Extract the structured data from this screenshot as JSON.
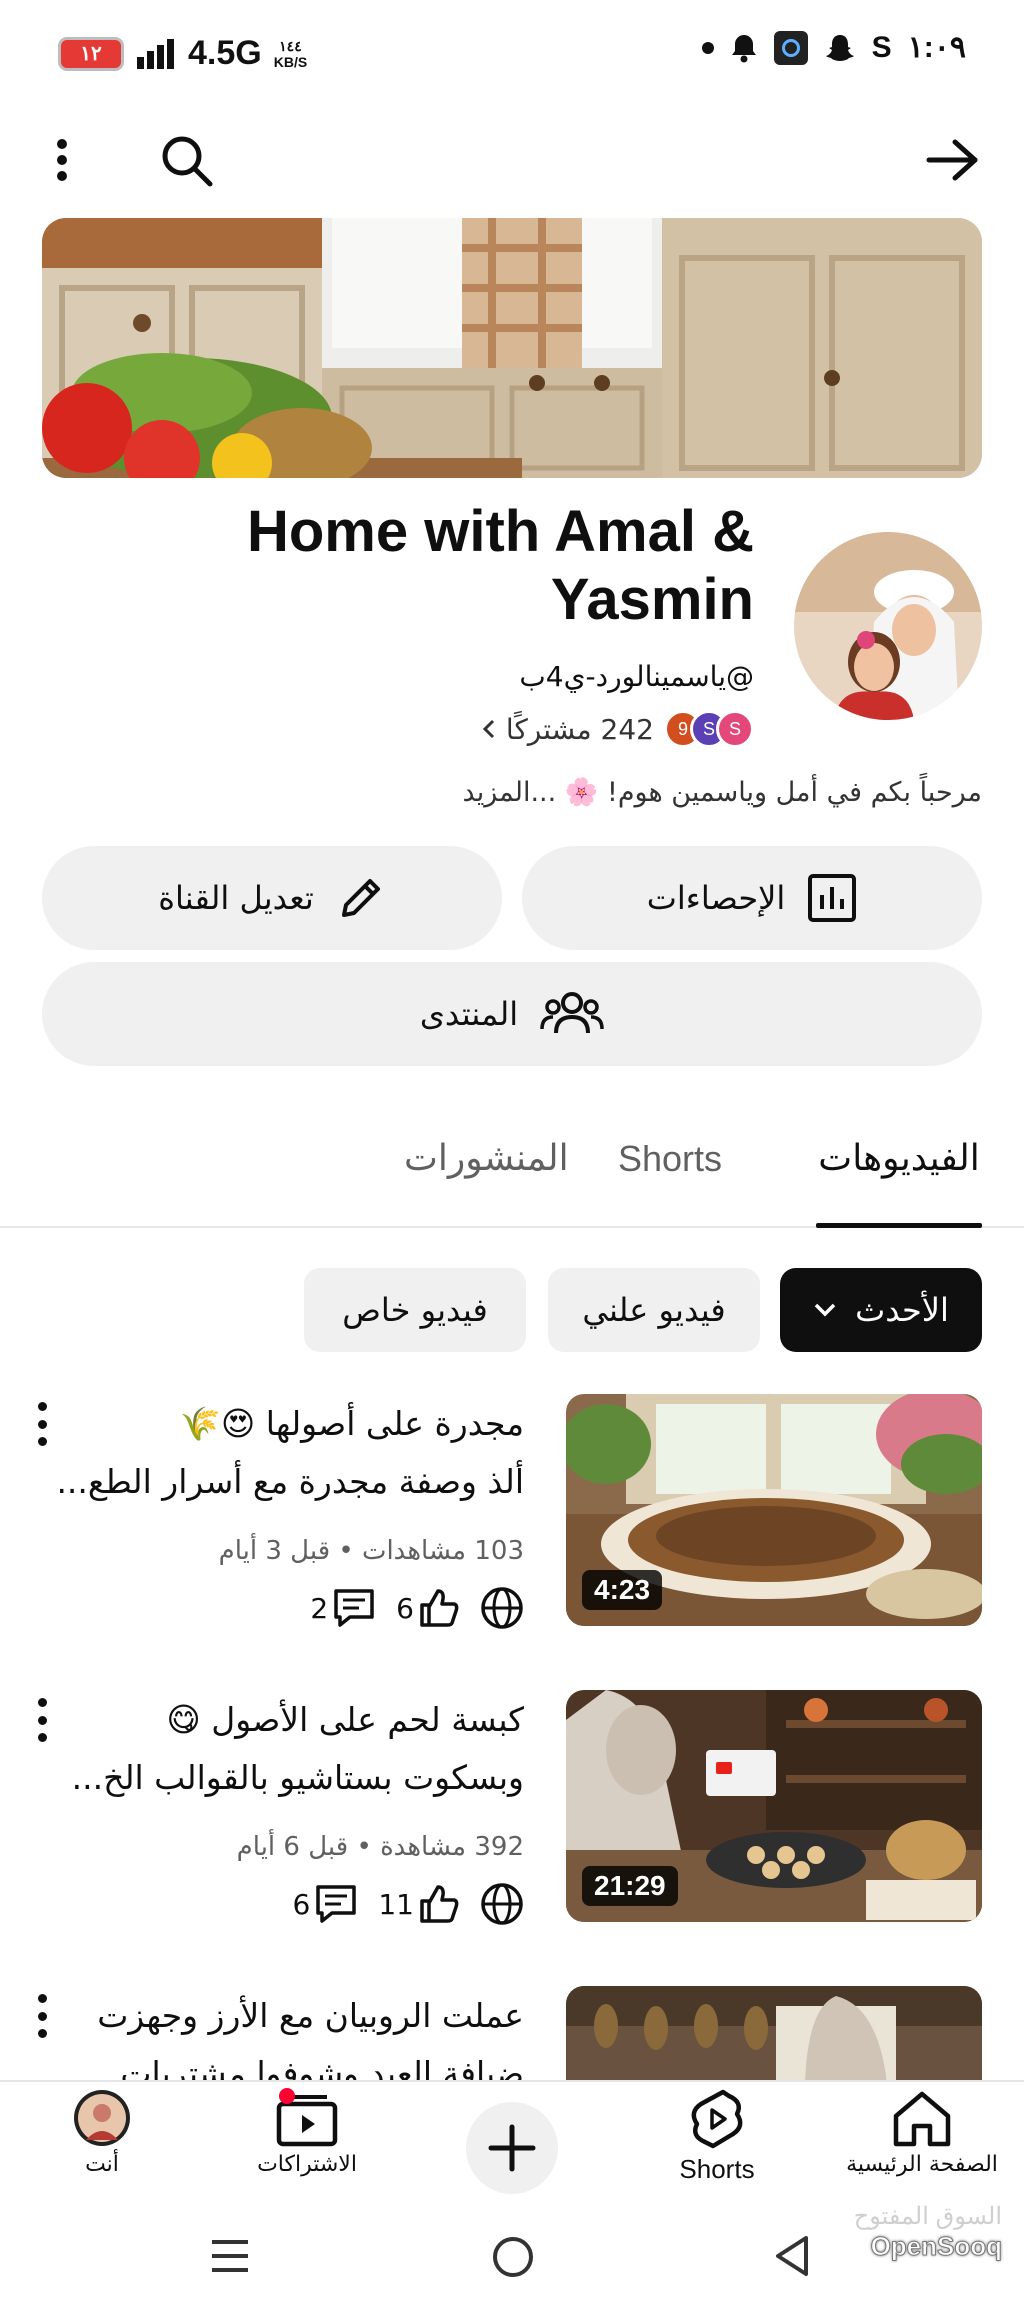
{
  "status_bar": {
    "battery": "١٢",
    "network": "4.5G",
    "speed_value": "١٤٤",
    "speed_unit": "KB/S",
    "time": "١:٠٩",
    "carrier_letter": "S"
  },
  "channel": {
    "title": "Home with Amal & Yasmin",
    "handle": "@ياسمينالورد-ي4ب",
    "subscribers": "242 مشتركًا",
    "description": "مرحباً بكم في أمل وياسمين هوم! 🌸 ...المزيد",
    "sub_avatars": [
      "S",
      "S",
      "9"
    ]
  },
  "actions": {
    "stats_label": "الإحصاءات",
    "edit_label": "تعديل القناة",
    "community_label": "المنتدى"
  },
  "tabs": {
    "videos": "الفيديوهات",
    "shorts": "Shorts",
    "posts": "المنشورات"
  },
  "filters": {
    "latest": "الأحدث",
    "public": "فيديو علني",
    "private": "فيديو خاص"
  },
  "videos": [
    {
      "title_line1": "مجدرة على أصولها 😍🌾",
      "title_line2": "ألذ وصفة مجدرة مع أسرار الطع...",
      "meta": "103 مشاهدات • قبل 3 أيام",
      "likes": "6",
      "comments": "2",
      "duration": "4:23"
    },
    {
      "title_line1": "كبسة لحم على الأصول 😋",
      "title_line2": "وبسكوت بستاشيو بالقوالب الخ...",
      "meta": "392 مشاهدة • قبل 6 أيام",
      "likes": "11",
      "comments": "6",
      "duration": "21:29"
    },
    {
      "title_line1": "عملت الروبيان مع الأرز وجهزت",
      "title_line2": "ضيافة العيد وشوفوا مشتريات..."
    }
  ],
  "bottom_nav": {
    "home": "الصفحة الرئيسية",
    "shorts": "Shorts",
    "subscriptions": "الاشتراكات",
    "you": "أنت"
  },
  "watermark": {
    "arabic": "السوق المفتوح",
    "english": "OpenSooq"
  }
}
